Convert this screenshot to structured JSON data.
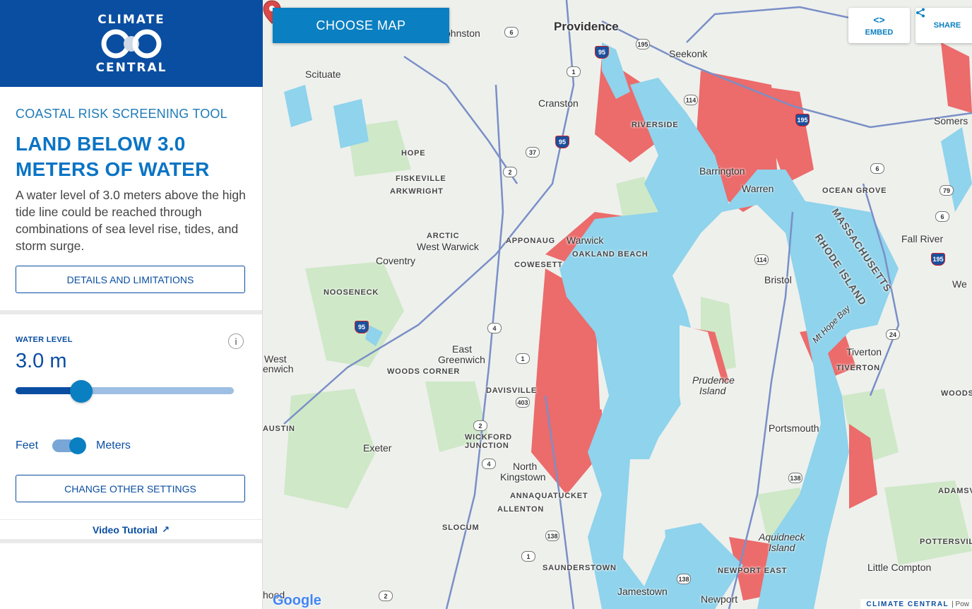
{
  "logo": {
    "line1": "CLIMATE",
    "line2": "CENTRAL"
  },
  "panel": {
    "eyebrow": "COASTAL RISK SCREENING TOOL",
    "headline": "LAND BELOW 3.0 METERS OF WATER",
    "body": "A water level of 3.0 meters above the high tide line could be reached through combinations of sea level rise, tides, and storm surge.",
    "details_button": "DETAILS AND LIMITATIONS"
  },
  "water_level": {
    "label": "WATER LEVEL",
    "value": "3.0 m",
    "slider_fraction": 0.3
  },
  "units": {
    "left": "Feet",
    "right": "Meters",
    "selected": "Meters"
  },
  "settings_button": "CHANGE OTHER SETTINGS",
  "video_tutorial": "Video Tutorial",
  "map": {
    "choose_map": "CHOOSE MAP",
    "embed_label": "EMBED",
    "share_label": "SHARE",
    "google": "Google",
    "attribution_brand": "CLIMATE CENTRAL",
    "attribution_extra": "| Pow",
    "colors": {
      "water": "#8fd3ec",
      "flood": "#ec6b6b",
      "land": "#eef0ec",
      "green": "#cfe8c8",
      "roads": "#7a8fc7"
    },
    "labels": [
      {
        "text": "Providence",
        "style": "big"
      },
      {
        "text": "ohnston",
        "style": "plain"
      },
      {
        "text": "Seekonk",
        "style": "plain"
      },
      {
        "text": "Scituate",
        "style": "plain"
      },
      {
        "text": "Cranston",
        "style": "plain"
      },
      {
        "text": "RIVERSIDE",
        "style": "caps"
      },
      {
        "text": "Somers",
        "style": "plain"
      },
      {
        "text": "HOPE",
        "style": "caps"
      },
      {
        "text": "Barrington",
        "style": "plain"
      },
      {
        "text": "Warren",
        "style": "plain"
      },
      {
        "text": "OCEAN GROVE",
        "style": "caps"
      },
      {
        "text": "FISKEVILLE",
        "style": "caps"
      },
      {
        "text": "ARKWRIGHT",
        "style": "caps"
      },
      {
        "text": "ARCTIC",
        "style": "caps"
      },
      {
        "text": "West Warwick",
        "style": "plain"
      },
      {
        "text": "APPONAUG",
        "style": "caps"
      },
      {
        "text": "Warwick",
        "style": "plain"
      },
      {
        "text": "OAKLAND BEACH",
        "style": "caps"
      },
      {
        "text": "Fall River",
        "style": "plain"
      },
      {
        "text": "Coventry",
        "style": "plain"
      },
      {
        "text": "COWESETT",
        "style": "caps"
      },
      {
        "text": "Bristol",
        "style": "plain"
      },
      {
        "text": "We",
        "style": "plain"
      },
      {
        "text": "NOOSENECK",
        "style": "caps"
      },
      {
        "text": "Mt Hope Bay",
        "style": "water"
      },
      {
        "text": "East",
        "style": "plain"
      },
      {
        "text": "Greenwich",
        "style": "plain"
      },
      {
        "text": "West",
        "style": "plain"
      },
      {
        "text": "enwich",
        "style": "plain"
      },
      {
        "text": "WOODS CORNER",
        "style": "caps"
      },
      {
        "text": "Tiverton",
        "style": "plain"
      },
      {
        "text": "TIVERTON",
        "style": "caps"
      },
      {
        "text": "DAVISVILLE",
        "style": "caps"
      },
      {
        "text": "Prudence",
        "style": "water"
      },
      {
        "text": "Island",
        "style": "water"
      },
      {
        "text": "WOODS",
        "style": "caps"
      },
      {
        "text": "AUSTIN",
        "style": "caps"
      },
      {
        "text": "Portsmouth",
        "style": "plain"
      },
      {
        "text": "Exeter",
        "style": "plain"
      },
      {
        "text": "WICKFORD",
        "style": "caps"
      },
      {
        "text": "JUNCTION",
        "style": "caps"
      },
      {
        "text": "North",
        "style": "plain"
      },
      {
        "text": "Kingstown",
        "style": "plain"
      },
      {
        "text": "ADAMSVIL",
        "style": "caps"
      },
      {
        "text": "ANNAQUATUCKET",
        "style": "caps"
      },
      {
        "text": "ALLENTON",
        "style": "caps"
      },
      {
        "text": "SLOCUM",
        "style": "caps"
      },
      {
        "text": "Aquidneck",
        "style": "water"
      },
      {
        "text": "Island",
        "style": "water"
      },
      {
        "text": "POTTERSVIL",
        "style": "caps"
      },
      {
        "text": "SAUNDERSTOWN",
        "style": "caps"
      },
      {
        "text": "NEWPORT EAST",
        "style": "caps"
      },
      {
        "text": "Little Compton",
        "style": "plain"
      },
      {
        "text": "Jamestown",
        "style": "plain"
      },
      {
        "text": "Newport",
        "style": "plain"
      },
      {
        "text": "hood",
        "style": "plain"
      }
    ],
    "state_labels": [
      "MASSACHUSETTS",
      "RHODE ISLAND"
    ],
    "shields": [
      "6",
      "195",
      "95",
      "1",
      "114",
      "195",
      "37",
      "95",
      "2",
      "6",
      "79",
      "6",
      "114",
      "195",
      "4",
      "1",
      "24",
      "95",
      "403",
      "2",
      "4",
      "138",
      "138",
      "1",
      "138",
      "2"
    ]
  }
}
